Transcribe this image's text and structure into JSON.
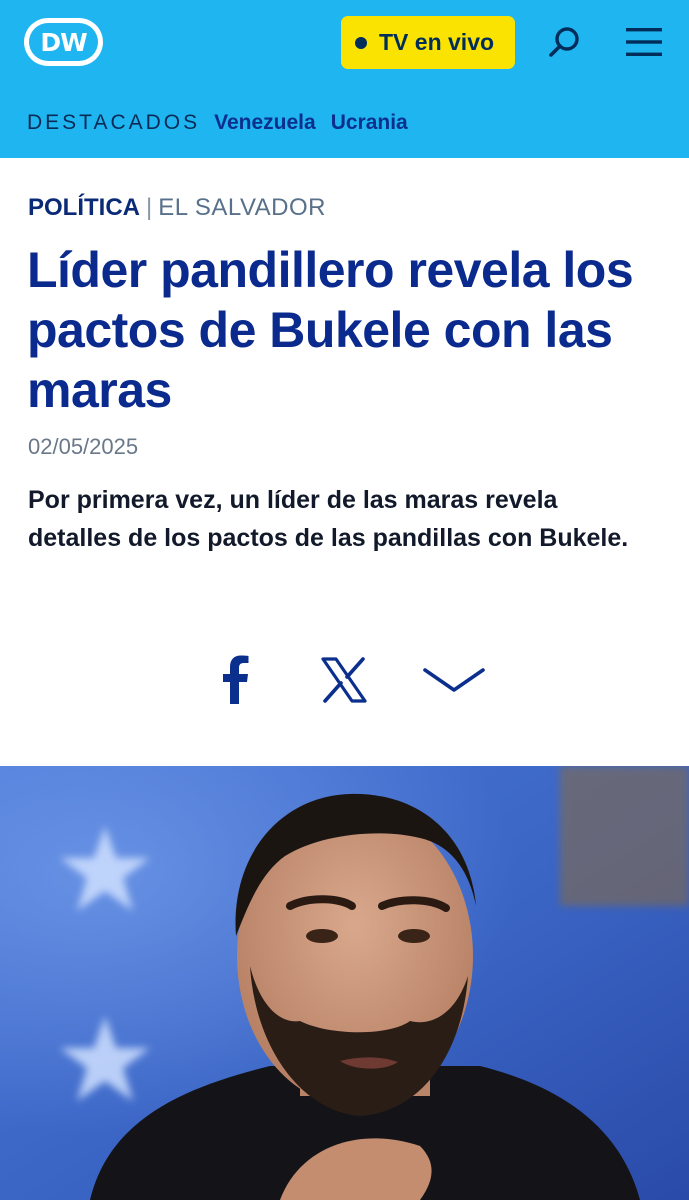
{
  "header": {
    "logo_text": "DW",
    "live_label": "TV en vivo",
    "icons": [
      "search-icon",
      "menu-icon"
    ]
  },
  "nav": {
    "title": "DESTACADOS",
    "links": [
      "Venezuela",
      "Ucrania"
    ]
  },
  "article": {
    "category": "POLÍTICA",
    "separator": "|",
    "subcategory": "EL SALVADOR",
    "headline": "Líder pandillero revela los pactos de Bukele con las maras",
    "date": "02/05/2025",
    "lead": "Por primera vez, un líder de las maras revela detalles de los pactos de las pandillas con Bukele."
  },
  "share": {
    "icons": [
      "facebook-icon",
      "x-icon",
      "chevron-down-icon"
    ]
  },
  "colors": {
    "header_bg": "#1eb5f0",
    "live_bg": "#fae300",
    "headline": "#0b2a8e",
    "nav_link": "#0b2f8c"
  }
}
